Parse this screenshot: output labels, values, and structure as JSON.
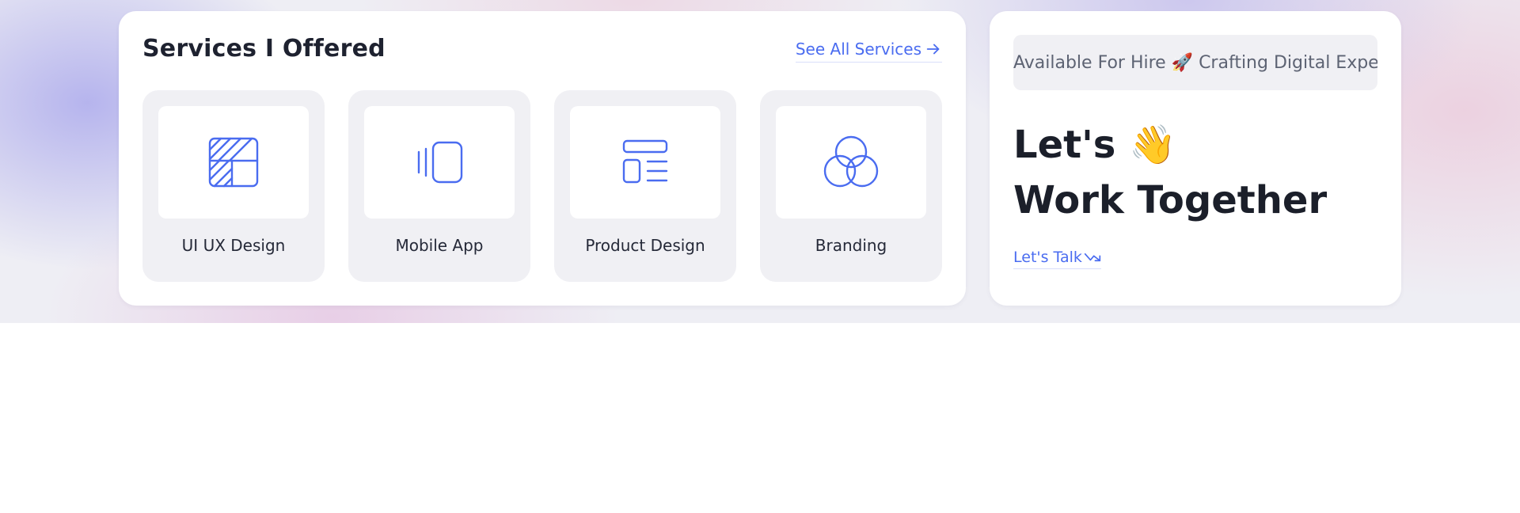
{
  "services": {
    "title": "Services I Offered",
    "see_all_label": "See All Services",
    "items": [
      {
        "label": "UI UX Design",
        "icon": "layout-hatched-icon"
      },
      {
        "label": "Mobile App",
        "icon": "mobile-app-icon"
      },
      {
        "label": "Product Design",
        "icon": "product-layout-icon"
      },
      {
        "label": "Branding",
        "icon": "three-circles-icon"
      }
    ]
  },
  "cta": {
    "marquee_text": "Available For Hire 🚀 Crafting Digital Experiences",
    "headline_line1": "Let's 👋",
    "headline_line2": "Work Together",
    "talk_label": "Let's Talk"
  },
  "colors": {
    "accent": "#4a6cf0",
    "heading": "#1b1f2a",
    "tile_bg": "#f0f0f4"
  }
}
